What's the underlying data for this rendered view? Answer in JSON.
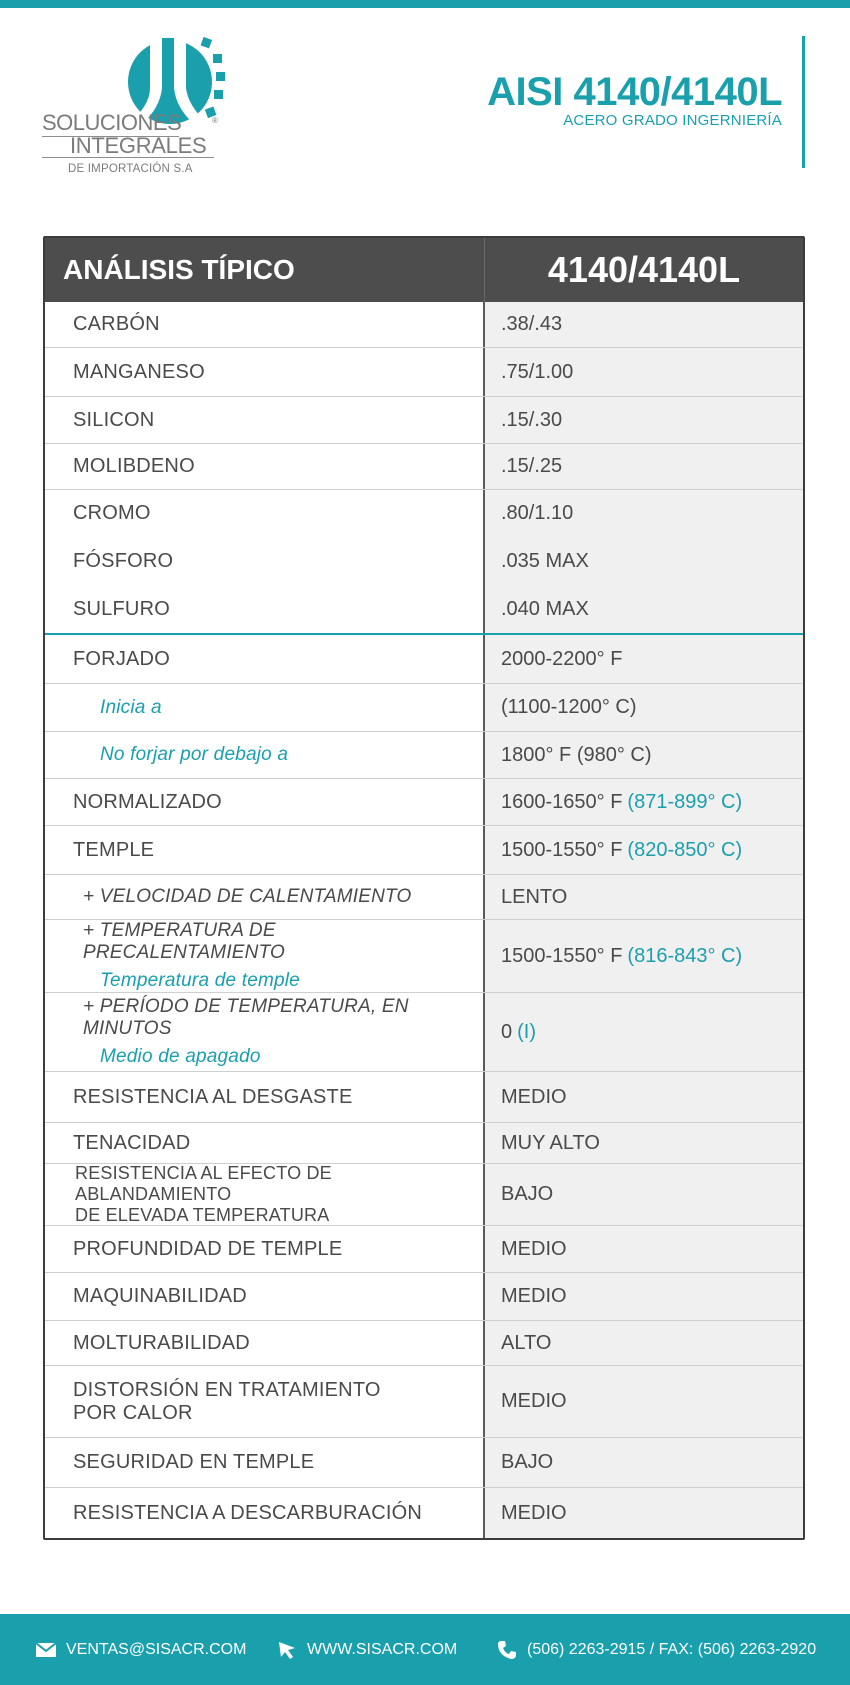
{
  "header": {
    "logo": {
      "line1": "SOLUCIONES",
      "line2": "INTEGRALES",
      "line3": "DE IMPORTACIÓN S.A",
      "reg": "®"
    },
    "title": "AISI 4140/4140L",
    "subtitle": "ACERO GRADO INGERNIERÍA"
  },
  "table": {
    "head_label": "ANÁLISIS TÍPICO",
    "head_value": "4140/4140L",
    "composition": [
      {
        "label": "CARBÓN",
        "value": ".38/.43"
      },
      {
        "label": "MANGANESO",
        "value": ".75/1.00"
      },
      {
        "label": "SILICON",
        "value": ".15/.30"
      },
      {
        "label": "MOLIBDENO",
        "value": ".15/.25"
      },
      {
        "label": "CROMO",
        "value": ".80/1.10"
      },
      {
        "label": "FÓSFORO",
        "value": ".035 MAX"
      },
      {
        "label": "SULFURO",
        "value": ".040 MAX"
      }
    ],
    "forjado": {
      "label": "FORJADO",
      "value": "2000-2200° F"
    },
    "inicia": {
      "label": "Inicia a",
      "value": "(1100-1200° C)"
    },
    "no_forjar": {
      "label": "No forjar por debajo a",
      "value": "1800° F (980° C)"
    },
    "normalizado": {
      "label": "NORMALIZADO",
      "value": "1600-1650° F",
      "value_c": "(871-899° C)"
    },
    "temple": {
      "label": "TEMPLE",
      "value": "1500-1550° F",
      "value_c": "(820-850° C)"
    },
    "velocidad": {
      "label": "+ VELOCIDAD DE CALENTAMIENTO",
      "value": "LENTO"
    },
    "precal": {
      "label": "+ TEMPERATURA DE PRECALENTAMIENTO",
      "label2": "Temperatura de temple",
      "value": "1500-1550° F",
      "value_c": "(816-843° C)"
    },
    "periodo": {
      "label": "+ PERÍODO DE TEMPERATURA, EN MINUTOS",
      "label2": "Medio de apagado",
      "value": "0",
      "value_c": "(I)"
    },
    "properties": [
      {
        "label": "RESISTENCIA AL DESGASTE",
        "value": "MEDIO"
      },
      {
        "label": "TENACIDAD",
        "value": "MUY ALTO"
      }
    ],
    "ablandamiento": {
      "label": "RESISTENCIA AL EFECTO DE ABLANDAMIENTO",
      "label2": "DE ELEVADA TEMPERATURA",
      "value": "BAJO"
    },
    "properties2": [
      {
        "label": "PROFUNDIDAD DE TEMPLE",
        "value": "MEDIO"
      },
      {
        "label": "MAQUINABILIDAD",
        "value": "MEDIO"
      },
      {
        "label": "MOLTURABILIDAD",
        "value": "ALTO"
      }
    ],
    "distorsion": {
      "label": "DISTORSIÓN EN TRATAMIENTO",
      "label2": "POR CALOR",
      "value": "MEDIO"
    },
    "properties3": [
      {
        "label": "SEGURIDAD EN TEMPLE",
        "value": "BAJO"
      },
      {
        "label": "RESISTENCIA A DESCARBURACIÓN",
        "value": "MEDIO"
      }
    ]
  },
  "footer": {
    "email": "VENTAS@SISACR.COM",
    "web": "WWW.SISACR.COM",
    "phone": "(506) 2263-2915 / FAX: (506) 2263-2920"
  },
  "colors": {
    "accent": "#1a9fad",
    "header_bg": "#4d4d4d",
    "value_bg": "#f0f0f1"
  }
}
